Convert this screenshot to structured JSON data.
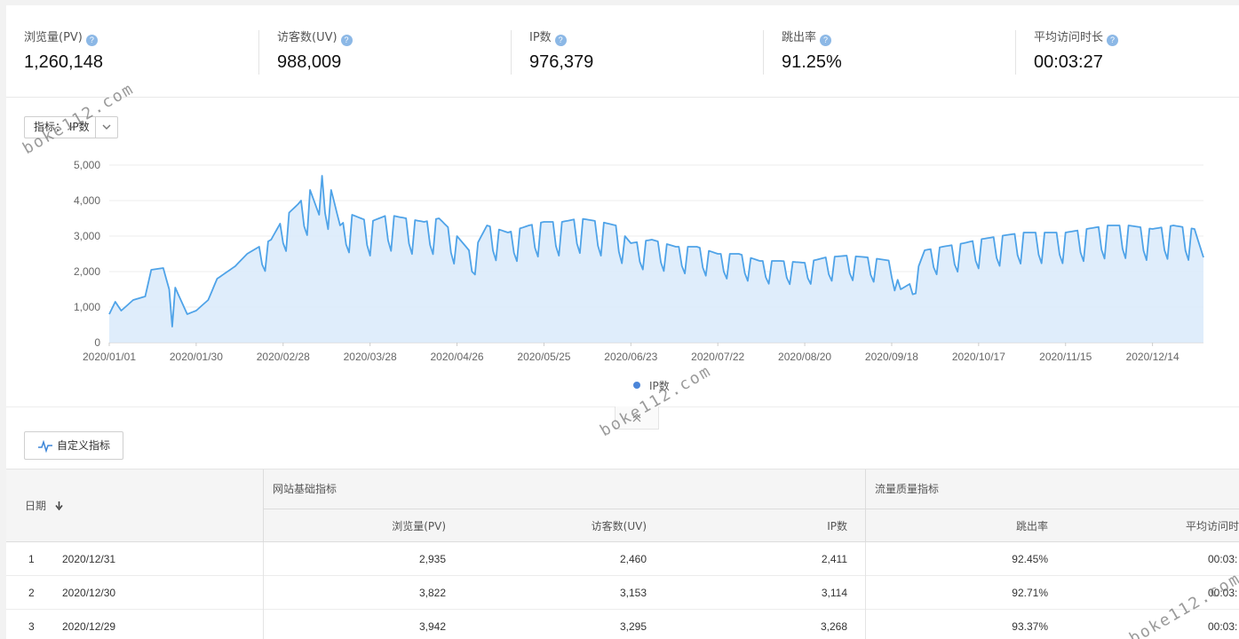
{
  "kpis": [
    {
      "label": "浏览量(PV)",
      "value": "1,260,148"
    },
    {
      "label": "访客数(UV)",
      "value": "988,009"
    },
    {
      "label": "IP数",
      "value": "976,379"
    },
    {
      "label": "跳出率",
      "value": "91.25%"
    },
    {
      "label": "平均访问时长",
      "value": "00:03:27"
    }
  ],
  "help_glyph": "?",
  "metric_select": {
    "text": "指标： IP数"
  },
  "chart_data": {
    "type": "area",
    "title": "",
    "series": [
      {
        "name": "IP数",
        "color": "#4fa3e8"
      }
    ],
    "y_ticks": [
      "0",
      "1,000",
      "2,000",
      "3,000",
      "4,000",
      "5,000"
    ],
    "ylim": [
      0,
      5000
    ],
    "x_ticks": [
      "2020/01/01",
      "2020/01/30",
      "2020/02/28",
      "2020/03/28",
      "2020/04/26",
      "2020/05/25",
      "2020/06/23",
      "2020/07/22",
      "2020/08/20",
      "2020/09/18",
      "2020/10/17",
      "2020/11/15",
      "2020/12/14"
    ],
    "x_start": "2020/01/01",
    "x_end": "2020/12/31",
    "key_points": [
      [
        "2020/01/01",
        800
      ],
      [
        "2020/01/03",
        1150
      ],
      [
        "2020/01/05",
        900
      ],
      [
        "2020/01/09",
        1200
      ],
      [
        "2020/01/13",
        1300
      ],
      [
        "2020/01/15",
        2050
      ],
      [
        "2020/01/19",
        2100
      ],
      [
        "2020/01/21",
        1500
      ],
      [
        "2020/01/22",
        450
      ],
      [
        "2020/01/23",
        1550
      ],
      [
        "2020/01/27",
        800
      ],
      [
        "2020/01/30",
        900
      ],
      [
        "2020/02/03",
        1200
      ],
      [
        "2020/02/06",
        1800
      ],
      [
        "2020/02/12",
        2150
      ],
      [
        "2020/02/16",
        2500
      ],
      [
        "2020/02/20",
        2700
      ],
      [
        "2020/02/24",
        2900
      ],
      [
        "2020/02/28",
        3500
      ],
      [
        "2020/03/04",
        3900
      ],
      [
        "2020/03/08",
        4300
      ],
      [
        "2020/03/11",
        3600
      ],
      [
        "2020/03/12",
        4700
      ],
      [
        "2020/03/15",
        4300
      ],
      [
        "2020/03/18",
        3300
      ],
      [
        "2020/03/22",
        3600
      ],
      [
        "2020/03/28",
        3400
      ],
      [
        "2020/04/03",
        3600
      ],
      [
        "2020/04/09",
        3500
      ],
      [
        "2020/04/15",
        3400
      ],
      [
        "2020/04/20",
        3500
      ],
      [
        "2020/04/26",
        3000
      ],
      [
        "2020/05/01",
        2500
      ],
      [
        "2020/05/06",
        3300
      ],
      [
        "2020/05/13",
        3100
      ],
      [
        "2020/05/20",
        3300
      ],
      [
        "2020/05/25",
        3400
      ],
      [
        "2020/05/31",
        3400
      ],
      [
        "2020/06/06",
        3500
      ],
      [
        "2020/06/13",
        3400
      ],
      [
        "2020/06/18",
        3300
      ],
      [
        "2020/06/23",
        2800
      ],
      [
        "2020/06/30",
        2900
      ],
      [
        "2020/07/08",
        2700
      ],
      [
        "2020/07/15",
        2700
      ],
      [
        "2020/07/22",
        2500
      ],
      [
        "2020/07/29",
        2500
      ],
      [
        "2020/08/05",
        2300
      ],
      [
        "2020/08/12",
        2300
      ],
      [
        "2020/08/20",
        2250
      ],
      [
        "2020/08/27",
        2400
      ],
      [
        "2020/09/03",
        2450
      ],
      [
        "2020/09/10",
        2400
      ],
      [
        "2020/09/18",
        2300
      ],
      [
        "2020/09/21",
        1500
      ],
      [
        "2020/09/25",
        1700
      ],
      [
        "2020/09/29",
        2600
      ],
      [
        "2020/10/05",
        2700
      ],
      [
        "2020/10/12",
        2800
      ],
      [
        "2020/10/17",
        2900
      ],
      [
        "2020/10/24",
        3000
      ],
      [
        "2020/11/01",
        3100
      ],
      [
        "2020/11/08",
        3100
      ],
      [
        "2020/11/15",
        3100
      ],
      [
        "2020/11/22",
        3200
      ],
      [
        "2020/11/29",
        3300
      ],
      [
        "2020/12/06",
        3300
      ],
      [
        "2020/12/14",
        3200
      ],
      [
        "2020/12/21",
        3300
      ],
      [
        "2020/12/28",
        3200
      ],
      [
        "2020/12/31",
        2400
      ]
    ]
  },
  "legend": {
    "label": "IP数"
  },
  "custom_button": {
    "label": "自定义指标"
  },
  "table": {
    "date_header": "日期",
    "group1": "网站基础指标",
    "group2": "流量质量指标",
    "columns": [
      "浏览量(PV)",
      "访客数(UV)",
      "IP数",
      "跳出率",
      "平均访问时"
    ],
    "rows": [
      {
        "index": "1",
        "date": "2020/12/31",
        "pv": "2,935",
        "uv": "2,460",
        "ip": "2,411",
        "bounce": "92.45%",
        "avg": "00:03:"
      },
      {
        "index": "2",
        "date": "2020/12/30",
        "pv": "3,822",
        "uv": "3,153",
        "ip": "3,114",
        "bounce": "92.71%",
        "avg": "00:03:"
      },
      {
        "index": "3",
        "date": "2020/12/29",
        "pv": "3,942",
        "uv": "3,295",
        "ip": "3,268",
        "bounce": "93.37%",
        "avg": "00:03:"
      }
    ]
  },
  "watermark": "boke112.com"
}
